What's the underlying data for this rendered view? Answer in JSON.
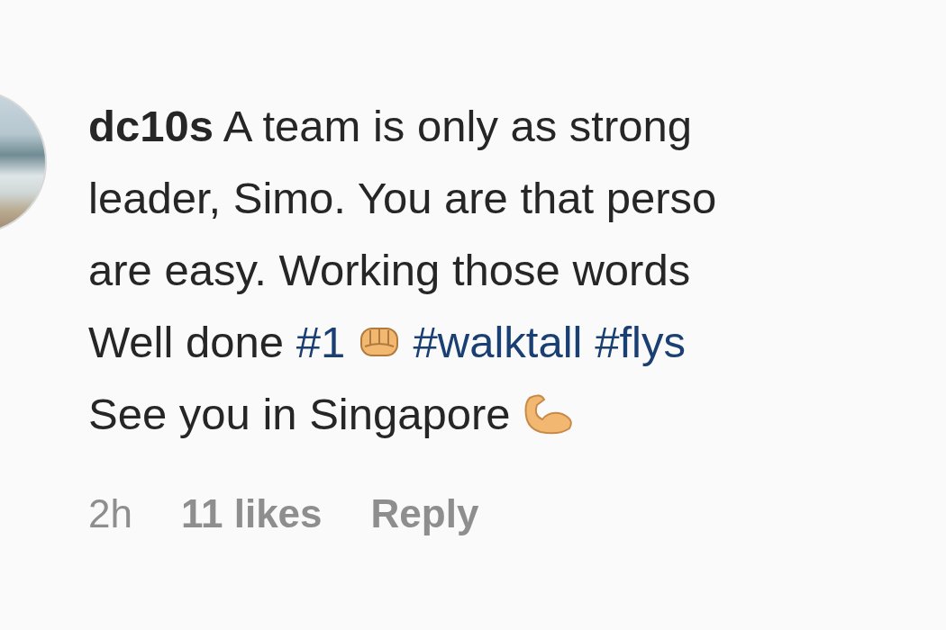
{
  "comment": {
    "username": "dc10s",
    "lines": [
      {
        "segments": [
          {
            "kind": "user"
          },
          {
            "kind": "text",
            "text": " A team is only as strong"
          }
        ]
      },
      {
        "segments": [
          {
            "kind": "text",
            "text": "leader, Simo. You are that perso"
          }
        ]
      },
      {
        "segments": [
          {
            "kind": "text",
            "text": "are easy. Working those words"
          }
        ]
      },
      {
        "segments": [
          {
            "kind": "text",
            "text": "Well done "
          },
          {
            "kind": "tag",
            "text": "#1"
          },
          {
            "kind": "space"
          },
          {
            "kind": "fist"
          },
          {
            "kind": "space"
          },
          {
            "kind": "tag",
            "text": "#walktall"
          },
          {
            "kind": "space"
          },
          {
            "kind": "tag",
            "text": "#flys"
          }
        ]
      },
      {
        "segments": [
          {
            "kind": "text",
            "text": "See you in Singapore "
          },
          {
            "kind": "arm"
          }
        ]
      }
    ],
    "time": "2h",
    "likes": "11 likes",
    "reply": "Reply"
  }
}
